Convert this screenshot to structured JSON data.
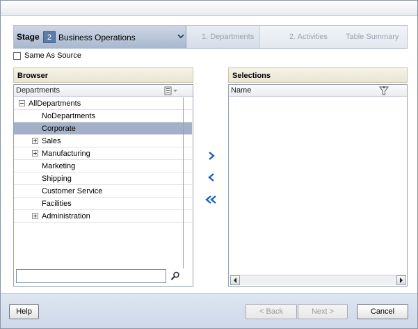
{
  "stage": {
    "label": "Stage",
    "number": "2",
    "name": "Business Operations",
    "steps": [
      "1. Departments",
      "2. Activities",
      "Table Summary"
    ]
  },
  "same_as_source": {
    "label": "Same As Source",
    "checked": false
  },
  "browser": {
    "title": "Browser",
    "column": "Departments",
    "tree": [
      {
        "label": "AllDepartments",
        "level": 0,
        "expander": "minus",
        "selected": false
      },
      {
        "label": "NoDepartments",
        "level": 1,
        "expander": "none",
        "selected": false
      },
      {
        "label": "Corporate",
        "level": 1,
        "expander": "none",
        "selected": true
      },
      {
        "label": "Sales",
        "level": 1,
        "expander": "plus",
        "selected": false
      },
      {
        "label": "Manufacturing",
        "level": 1,
        "expander": "plus",
        "selected": false
      },
      {
        "label": "Marketing",
        "level": 1,
        "expander": "none",
        "selected": false
      },
      {
        "label": "Shipping",
        "level": 1,
        "expander": "none",
        "selected": false
      },
      {
        "label": "Customer Service",
        "level": 1,
        "expander": "none",
        "selected": false
      },
      {
        "label": "Facilities",
        "level": 1,
        "expander": "none",
        "selected": false
      },
      {
        "label": "Administration",
        "level": 1,
        "expander": "plus",
        "selected": false
      }
    ],
    "search_value": ""
  },
  "selections": {
    "title": "Selections",
    "column": "Name"
  },
  "footer": {
    "help": "Help",
    "back": "< Back",
    "next": "Next >",
    "cancel": "Cancel"
  },
  "colors": {
    "accent": "#5d7da8",
    "selected_row": "#a2b0c8",
    "arrow_blue": "#1f5fbf"
  }
}
